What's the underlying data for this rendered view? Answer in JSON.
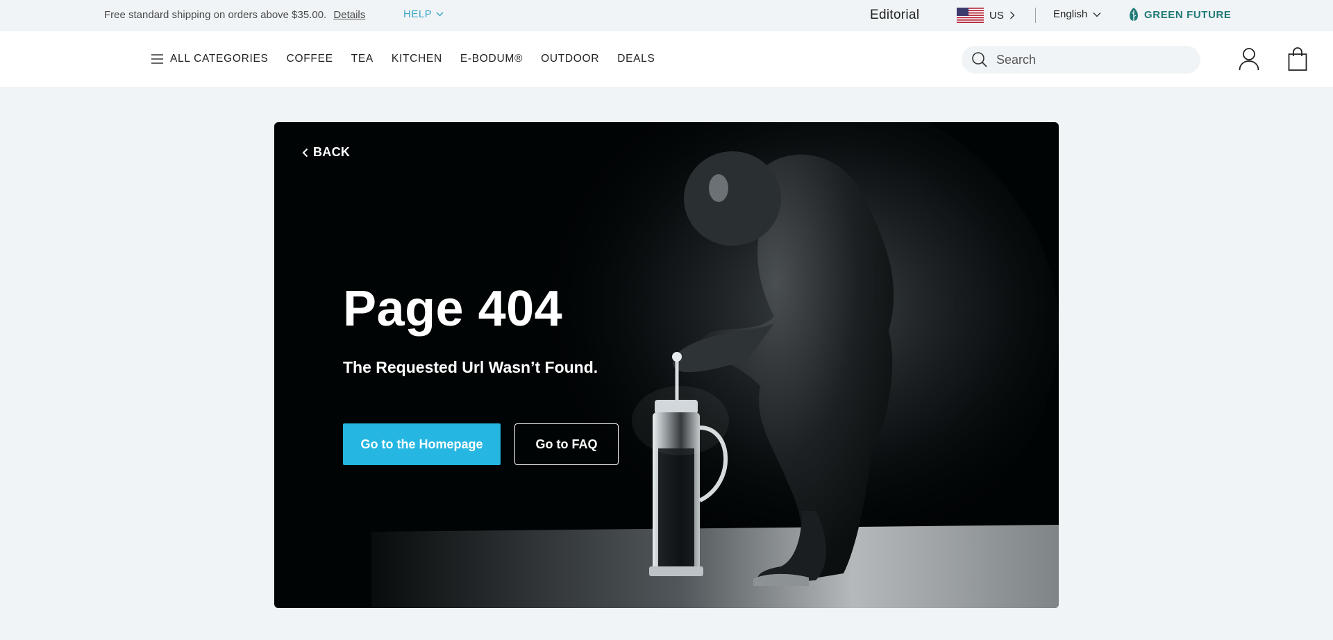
{
  "topbar": {
    "shipping_text": "Free standard shipping on orders above $35.00.",
    "details_link": "Details",
    "help_label": "HELP",
    "editorial_label": "Editorial",
    "country_code": "US",
    "language": "English",
    "green_future_label": "GREEN FUTURE"
  },
  "nav": {
    "items": [
      {
        "label": "ALL CATEGORIES",
        "icon": "hamburger-menu-icon"
      },
      {
        "label": "COFFEE"
      },
      {
        "label": "TEA"
      },
      {
        "label": "KITCHEN"
      },
      {
        "label": "E-BODUM®"
      },
      {
        "label": "OUTDOOR"
      },
      {
        "label": "DEALS"
      }
    ],
    "search_placeholder": "Search"
  },
  "hero": {
    "back_label": "BACK",
    "title": "Page 404",
    "subtitle": "The Requested Url Wasn’t Found.",
    "primary_button": "Go to the Homepage",
    "secondary_button": "Go to FAQ",
    "image": "chimpanzee-pressing-french-press-photo"
  },
  "colors": {
    "page_bg": "#f0f4f6",
    "accent_blue": "#25b6e2",
    "help_blue": "#3aa7c7",
    "green_future": "#1f7a76",
    "hero_bg": "#010405"
  }
}
